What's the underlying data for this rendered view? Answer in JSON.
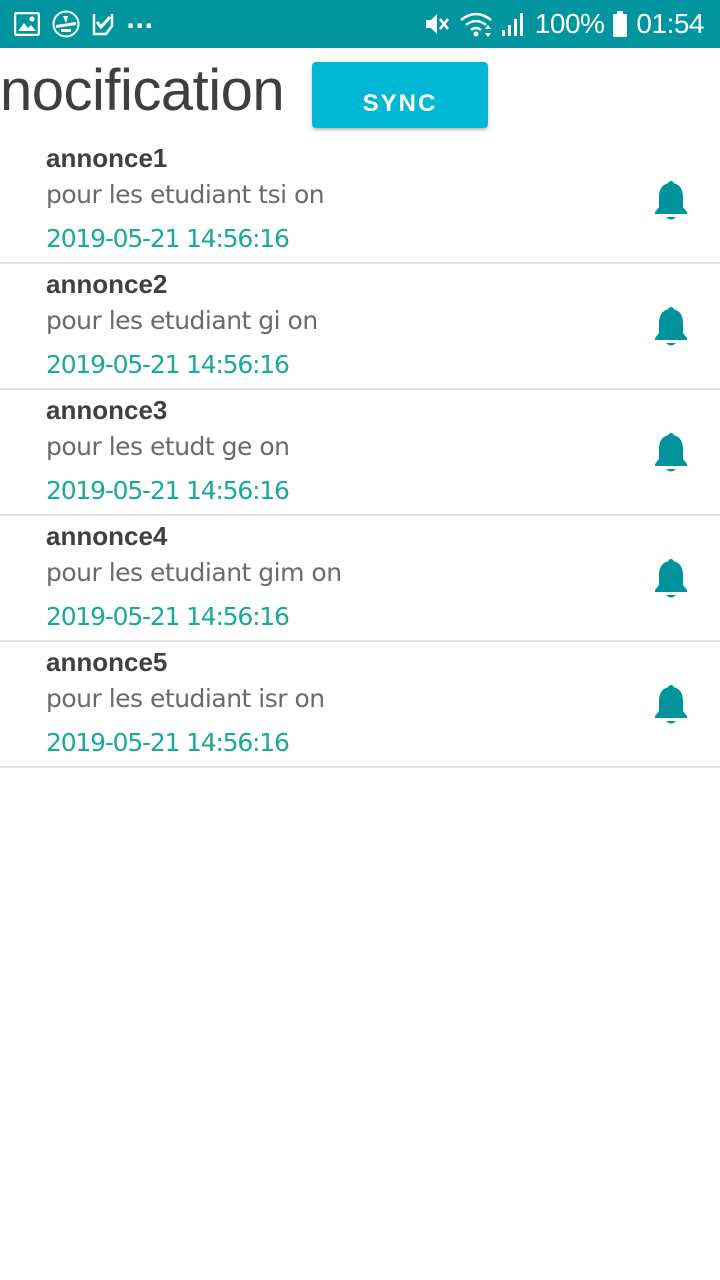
{
  "status_bar": {
    "battery_text": "100%",
    "time": "01:54",
    "overflow": "...",
    "icons": [
      "gallery-icon",
      "app-icon",
      "task-icon",
      "mute-icon",
      "wifi-icon",
      "signal-icon",
      "battery-icon"
    ]
  },
  "header": {
    "title": "nocification",
    "sync_label": "SYNC"
  },
  "colors": {
    "status_bar": "#00959f",
    "sync_button": "#00b8d4",
    "date_text": "#1aa99a",
    "bell_icon": "#00939b"
  },
  "notifications": [
    {
      "title": "annonce1",
      "body": "pour les etudiant tsi on",
      "date": "2019-05-21 14:56:16",
      "icon": "bell-icon"
    },
    {
      "title": "annonce2",
      "body": "pour les etudiant gi on",
      "date": "2019-05-21 14:56:16",
      "icon": "bell-icon"
    },
    {
      "title": "annonce3",
      "body": "pour les etudt ge on",
      "date": "2019-05-21 14:56:16",
      "icon": "bell-icon"
    },
    {
      "title": "annonce4",
      "body": "pour les etudiant gim on",
      "date": "2019-05-21 14:56:16",
      "icon": "bell-icon"
    },
    {
      "title": "annonce5",
      "body": "pour les etudiant isr on",
      "date": "2019-05-21 14:56:16",
      "icon": "bell-icon"
    }
  ]
}
